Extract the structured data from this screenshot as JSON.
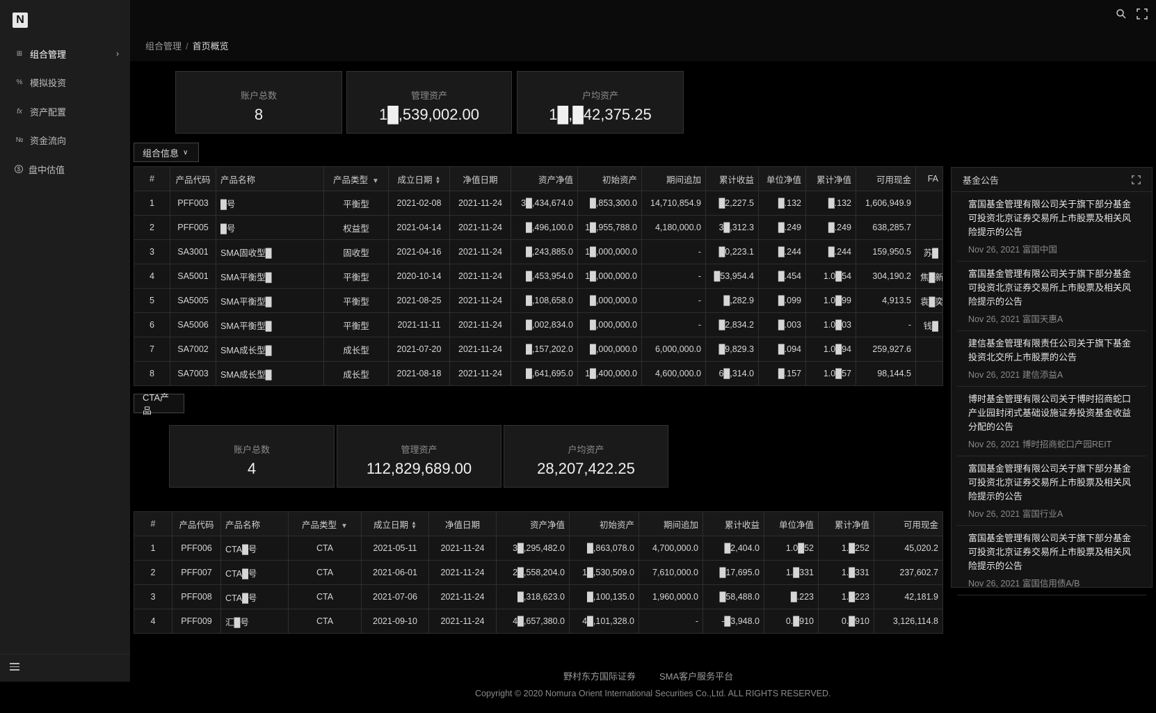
{
  "app": {
    "logo": "N"
  },
  "sidebar": {
    "items": [
      {
        "label": "组合管理",
        "icon": "portfolio-icon",
        "glyph": "⊞"
      },
      {
        "label": "模拟投资",
        "icon": "percent-icon",
        "glyph": "%"
      },
      {
        "label": "资产配置",
        "icon": "function-icon",
        "glyph": "fx"
      },
      {
        "label": "资金流向",
        "icon": "numero-icon",
        "glyph": "№"
      },
      {
        "label": "盘中估值",
        "icon": "dollar-icon",
        "glyph": "$"
      }
    ]
  },
  "breadcrumb": {
    "parent": "组合管理",
    "separator": "/",
    "current": "首页概览"
  },
  "portfolio": {
    "stats": [
      {
        "label": "账户总数",
        "value": "8"
      },
      {
        "label": "管理资产",
        "value": "1█,539,002.00"
      },
      {
        "label": "户均资产",
        "value": "1█,█42,375.25"
      }
    ],
    "section_label": "组合信息",
    "headers": [
      "#",
      "产品代码",
      "产品名称",
      "产品类型",
      "成立日期",
      "净值日期",
      "资产净值",
      "初始资产",
      "期间追加",
      "累计收益",
      "单位净值",
      "累计净值",
      "可用现金",
      "FA"
    ],
    "rows": [
      [
        "1",
        "PFF003",
        "█号",
        "平衡型",
        "2021-02-08",
        "2021-11-24",
        "3█,434,674.0",
        "█,853,300.0",
        "14,710,854.9",
        "█2,227.5",
        "█.132",
        "█.132",
        "1,606,949.9",
        ""
      ],
      [
        "2",
        "PFF005",
        "█号",
        "权益型",
        "2021-04-14",
        "2021-11-24",
        "█,496,100.0",
        "1█,955,788.0",
        "4,180,000.0",
        "3█,312.3",
        "█.249",
        "█.249",
        "638,285.7",
        ""
      ],
      [
        "3",
        "SA3001",
        "SMA固收型█",
        "固收型",
        "2021-04-16",
        "2021-11-24",
        "█,243,885.0",
        "1█,000,000.0",
        "-",
        "█0,223.1",
        "█.244",
        "█.244",
        "159,950.5",
        "苏█"
      ],
      [
        "4",
        "SA5001",
        "SMA平衡型█",
        "平衡型",
        "2020-10-14",
        "2021-11-24",
        "█,453,954.0",
        "1█,000,000.0",
        "-",
        "█53,954.4",
        "█.454",
        "1.0█54",
        "304,190.2",
        "焦█新"
      ],
      [
        "5",
        "SA5005",
        "SMA平衡型█",
        "平衡型",
        "2021-08-25",
        "2021-11-24",
        "█,108,658.0",
        "█,000,000.0",
        "-",
        "█,282.9",
        "█.099",
        "1.0█99",
        "4,913.5",
        "袁█奕"
      ],
      [
        "6",
        "SA5006",
        "SMA平衡型█",
        "平衡型",
        "2021-11-11",
        "2021-11-24",
        "█,002,834.0",
        "█,000,000.0",
        "-",
        "█2,834.2",
        "█.003",
        "1.0█03",
        "-",
        "钱█"
      ],
      [
        "7",
        "SA7002",
        "SMA成长型█",
        "成长型",
        "2021-07-20",
        "2021-11-24",
        "█,157,202.0",
        "█,000,000.0",
        "6,000,000.0",
        "█9,829.3",
        "█.094",
        "1.0█94",
        "259,927.6",
        ""
      ],
      [
        "8",
        "SA7003",
        "SMA成长型█",
        "成长型",
        "2021-08-18",
        "2021-11-24",
        "█,641,695.0",
        "1█,400,000.0",
        "4,600,000.0",
        "6█,314.0",
        "█.157",
        "1.0█57",
        "98,144.5",
        ""
      ]
    ]
  },
  "cta": {
    "section_label": "CTA产品",
    "stats": [
      {
        "label": "账户总数",
        "value": "4"
      },
      {
        "label": "管理资产",
        "value": "112,829,689.00"
      },
      {
        "label": "户均资产",
        "value": "28,207,422.25"
      }
    ],
    "headers": [
      "#",
      "产品代码",
      "产品名称",
      "产品类型",
      "成立日期",
      "净值日期",
      "资产净值",
      "初始资产",
      "期间追加",
      "累计收益",
      "单位净值",
      "累计净值",
      "可用现金"
    ],
    "rows": [
      [
        "1",
        "PFF006",
        "CTA█号",
        "CTA",
        "2021-05-11",
        "2021-11-24",
        "3█,295,482.0",
        "█,863,078.0",
        "4,700,000.0",
        "█2,404.0",
        "1.0█52",
        "1.█252",
        "45,020.2"
      ],
      [
        "2",
        "PFF007",
        "CTA█号",
        "CTA",
        "2021-06-01",
        "2021-11-24",
        "2█,558,204.0",
        "1█,530,509.0",
        "7,610,000.0",
        "█17,695.0",
        "1.█331",
        "1.█331",
        "237,602.7"
      ],
      [
        "3",
        "PFF008",
        "CTA█号",
        "CTA",
        "2021-07-06",
        "2021-11-24",
        "█,318,623.0",
        "█,100,135.0",
        "1,960,000.0",
        "█58,488.0",
        "█.223",
        "1.█223",
        "42,181.9"
      ],
      [
        "4",
        "PFF009",
        "汇█号",
        "CTA",
        "2021-09-10",
        "2021-11-24",
        "4█,657,380.0",
        "4█,101,328.0",
        "-",
        "-█3,948.0",
        "0.█910",
        "0.█910",
        "3,126,114.8"
      ]
    ]
  },
  "announcements": {
    "title": "基金公告",
    "items": [
      {
        "title": "富国基金管理有限公司关于旗下部分基金可投资北京证券交易所上市股票及相关风险提示的公告",
        "meta": "Nov 26, 2021 富国中国"
      },
      {
        "title": "富国基金管理有限公司关于旗下部分基金可投资北京证券交易所上市股票及相关风险提示的公告",
        "meta": "Nov 26, 2021 富国天惠A"
      },
      {
        "title": "建信基金管理有限责任公司关于旗下基金投资北交所上市股票的公告",
        "meta": "Nov 26, 2021 建信添益A"
      },
      {
        "title": "博时基金管理有限公司关于博时招商蛇口产业园封闭式基础设施证券投资基金收益分配的公告",
        "meta": "Nov 26, 2021 博时招商蛇口产园REIT"
      },
      {
        "title": "富国基金管理有限公司关于旗下部分基金可投资北京证券交易所上市股票及相关风险提示的公告",
        "meta": "Nov 26, 2021 富国行业A"
      },
      {
        "title": "富国基金管理有限公司关于旗下部分基金可投资北京证券交易所上市股票及相关风险提示的公告",
        "meta": "Nov 26, 2021 富国信用债A/B"
      }
    ]
  },
  "footer": {
    "links": [
      "野村东方国际证券",
      "SMA客户服务平台"
    ],
    "copyright": "Copyright © 2020 Nomura Orient International Securities Co.,Ltd. ALL RIGHTS RESERVED."
  }
}
